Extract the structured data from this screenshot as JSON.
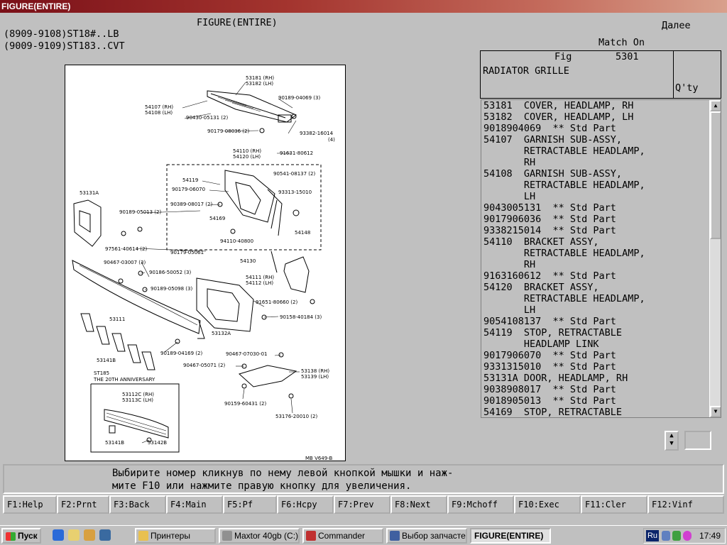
{
  "window": {
    "title": "FIGURE(ENTIRE)"
  },
  "header": {
    "figure_title": "FIGURE(ENTIRE)",
    "model_line1": "(8909-9108)ST18#..LB",
    "model_line2": "(9009-9109)ST183..CVT",
    "next_label": "Далее",
    "match_label": "Match On"
  },
  "fig_info": {
    "fig_label": "Fig",
    "fig_number": "5301",
    "name": "RADIATOR GRILLE",
    "qty_label": "Q'ty"
  },
  "parts": [
    "53181  COVER, HEADLAMP, RH",
    "53182  COVER, HEADLAMP, LH",
    "9018904069  ** Std Part",
    "54107  GARNISH SUB-ASSY,",
    "       RETRACTABLE HEADLAMP,",
    "       RH",
    "54108  GARNISH SUB-ASSY,",
    "       RETRACTABLE HEADLAMP,",
    "       LH",
    "9043005131  ** Std Part",
    "9017906036  ** Std Part",
    "9338215014  ** Std Part",
    "54110  BRACKET ASSY,",
    "       RETRACTABLE HEADLAMP,",
    "       RH",
    "9163160612  ** Std Part",
    "54120  BRACKET ASSY,",
    "       RETRACTABLE HEADLAMP,",
    "       LH",
    "9054108137  ** Std Part",
    "54119  STOP, RETRACTABLE",
    "       HEADLAMP LINK",
    "9017906070  ** Std Part",
    "9331315010  ** Std Part",
    "53131A DOOR, HEADLAMP, RH",
    "9038908017  ** Std Part",
    "9018905013  ** Std Part",
    "54169  STOP, RETRACTABLE"
  ],
  "diagram": {
    "labels": [
      "53181",
      "53182",
      "90189-04069",
      "54107",
      "54108",
      "90430-05131",
      "90179-08036",
      "93382-16014",
      "54110",
      "54120",
      "91631-80612",
      "54119",
      "90179-06070",
      "90541-08137",
      "93313-15010",
      "53131A",
      "90389-08017",
      "90189-05013",
      "54169",
      "94110-40800",
      "54148",
      "97561-40614",
      "90179-05061",
      "54130",
      "90467-03007",
      "90186-50052",
      "90189-05098",
      "54111",
      "54112",
      "91651-80660",
      "53111",
      "90158-40184",
      "53132A",
      "90189-04169",
      "53141B",
      "90467-07030-01",
      "90467-05071",
      "53138",
      "53139",
      "90159-60431",
      "53176-20010",
      "ST185",
      "THE 20TH ANNIVERSARY",
      "53112C",
      "53113C",
      "53141B",
      "53142B",
      "MB V649-B"
    ]
  },
  "message": {
    "line1": "Выбирите номер кликнув по нему левой кнопкой мышки и наж-",
    "line2": "мите F10 или нажмите правую кнопку для увеличения."
  },
  "fkeys": [
    "F1:Help",
    "F2:Prnt",
    "F3:Back",
    "F4:Main",
    "F5:Pf",
    "F6:Hcpy",
    "F7:Prev",
    "F8:Next",
    "F9:Mchoff",
    "F10:Exec",
    "F11:Cler",
    "F12:Vinf"
  ],
  "taskbar": {
    "start": "Пуск",
    "tasks": [
      "Принтеры",
      "Maxtor 40gb (C:)",
      "Commander",
      "Выбор запчасте...",
      "FIGURE(ENTIRE)"
    ],
    "lang": "Ru",
    "clock": "17:49"
  }
}
